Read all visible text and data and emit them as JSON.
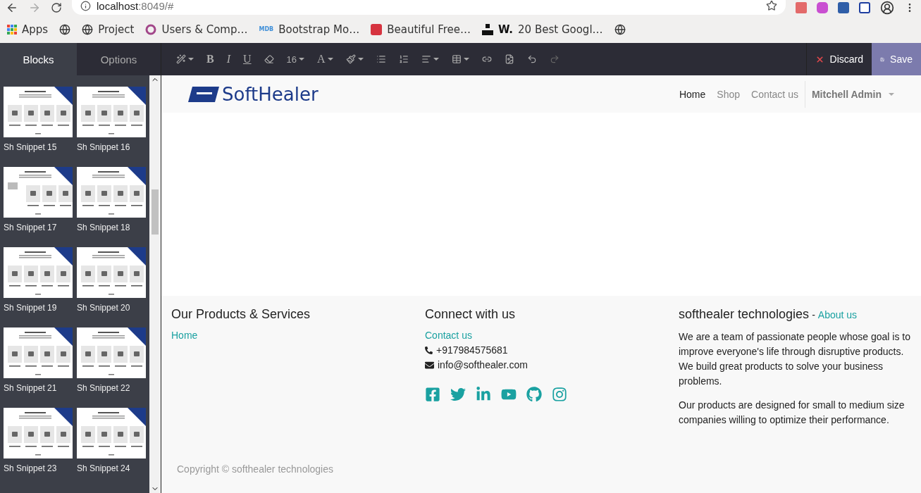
{
  "browser": {
    "url_host": "localhost",
    "url_rest": ":8049/#",
    "bookmarks": [
      {
        "kind": "apps",
        "label": "Apps"
      },
      {
        "kind": "globe"
      },
      {
        "kind": "globe",
        "label": "Project"
      },
      {
        "kind": "ring",
        "label": "Users & Comp…"
      },
      {
        "kind": "text-logo",
        "icon_text": "MDB",
        "label": "Bootstrap Mo…"
      },
      {
        "kind": "red-square",
        "label": "Beautiful Free…"
      },
      {
        "kind": "blocks",
        "label": "20 Best Googl…",
        "icon_text": "W."
      },
      {
        "kind": "globe"
      }
    ]
  },
  "editor": {
    "tabs": [
      {
        "label": "Blocks",
        "selected": true
      },
      {
        "label": "Options",
        "selected": false
      }
    ],
    "toolbar": [
      {
        "kind": "wand",
        "dropdown": true
      },
      {
        "kind": "bold",
        "label": "B"
      },
      {
        "kind": "italic",
        "label": "I"
      },
      {
        "kind": "underline",
        "label": "U"
      },
      {
        "kind": "eraser"
      },
      {
        "kind": "size",
        "label": "16",
        "dropdown": true
      },
      {
        "kind": "font",
        "label": "A",
        "dropdown": true
      },
      {
        "kind": "brush",
        "dropdown": true
      },
      {
        "kind": "bullets"
      },
      {
        "kind": "numbers"
      },
      {
        "kind": "align",
        "dropdown": true
      },
      {
        "kind": "table",
        "dropdown": true
      },
      {
        "kind": "link"
      },
      {
        "kind": "image"
      },
      {
        "kind": "undo"
      },
      {
        "kind": "redo",
        "disabled": true
      }
    ],
    "discard": "Discard",
    "save": "Save"
  },
  "snippets": [
    {
      "label": "Sh Snippet 15"
    },
    {
      "label": "Sh Snippet 16"
    },
    {
      "label": "Sh Snippet 17"
    },
    {
      "label": "Sh Snippet 18"
    },
    {
      "label": "Sh Snippet 19"
    },
    {
      "label": "Sh Snippet 20"
    },
    {
      "label": "Sh Snippet 21"
    },
    {
      "label": "Sh Snippet 22"
    },
    {
      "label": "Sh Snippet 23"
    },
    {
      "label": "Sh Snippet 24"
    }
  ],
  "site": {
    "logo": "SoftHealer",
    "nav": [
      {
        "label": "Home",
        "selected": true
      },
      {
        "label": "Shop",
        "selected": false
      },
      {
        "label": "Contact us",
        "selected": false
      }
    ],
    "user": "Mitchell Admin"
  },
  "footer": {
    "products": {
      "title": "Our Products & Services",
      "links": [
        "Home"
      ]
    },
    "connect": {
      "title": "Connect with us",
      "link": "Contact us",
      "phone": "+917984575681",
      "email": "info@softhealer.com"
    },
    "about": {
      "title": "softhealer technologies",
      "separator": "-",
      "link": "About us",
      "paragraphs": [
        "We are a team of passionate people whose goal is to improve everyone's life through disruptive products. We build great products to solve your business problems.",
        "Our products are designed for small to medium size companies willing to optimize their performance."
      ]
    },
    "copyright": "Copyright © softhealer technologies"
  }
}
